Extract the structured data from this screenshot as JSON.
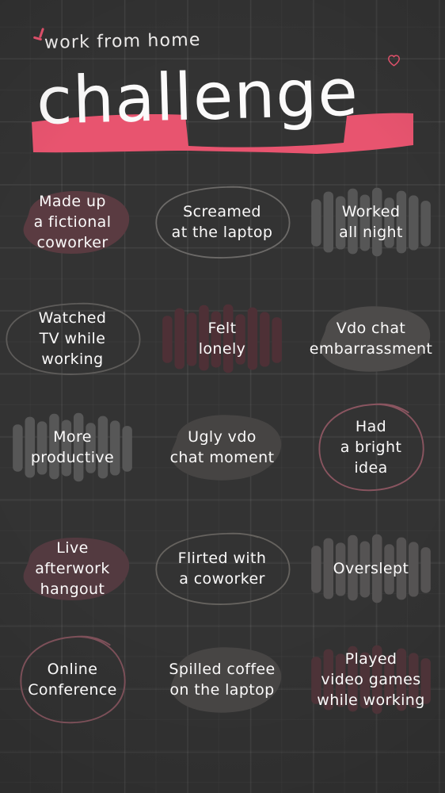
{
  "poster": {
    "background_color": "#333333",
    "accent_color": "#e8546f",
    "text_color": "#fbfafa",
    "kicker": "work from home",
    "headline": "challenge",
    "heart_icon": "heart-icon",
    "banner_color": "#e8546f"
  },
  "cells": [
    {
      "id": "made-up-a-fictional-coworker",
      "text": "Made up\na fictional\ncoworker",
      "highlight": "blob-maroon",
      "highlight_color": "#5a3b41",
      "row": 1,
      "col": 1
    },
    {
      "id": "screamed-at-the-laptop",
      "text": "Screamed\nat the laptop",
      "highlight": "outline-oval-gray",
      "highlight_color": "#6c6a68",
      "row": 1,
      "col": 2
    },
    {
      "id": "worked-all-night",
      "text": "Worked\nall night",
      "highlight": "brush-gray",
      "highlight_color": "#565656",
      "row": 1,
      "col": 3
    },
    {
      "id": "watched-tv-while-working",
      "text": "Watched\nTV while\nworking",
      "highlight": "outline-oval-gray",
      "highlight_color": "#5e5c5a",
      "row": 2,
      "col": 1
    },
    {
      "id": "felt-lonely",
      "text": "Felt\nlonely",
      "highlight": "brush-maroon",
      "highlight_color": "#4e3036",
      "row": 2,
      "col": 2
    },
    {
      "id": "vdo-chat-embarrassment",
      "text": "Vdo chat\nembarrassment",
      "highlight": "blob-gray",
      "highlight_color": "#4d4b4a",
      "row": 2,
      "col": 3
    },
    {
      "id": "more-productive",
      "text": "More\nproductive",
      "highlight": "brush-gray",
      "highlight_color": "#575757",
      "row": 3,
      "col": 1
    },
    {
      "id": "ugly-vdo-chat-moment",
      "text": "Ugly vdo\nchat moment",
      "highlight": "blob-gray",
      "highlight_color": "#464443",
      "row": 3,
      "col": 2
    },
    {
      "id": "had-a-bright-idea",
      "text": "Had\na bright\nidea",
      "highlight": "outline-circle-pink",
      "highlight_color": "#8a5560",
      "row": 3,
      "col": 3
    },
    {
      "id": "live-afterwork-hangout",
      "text": "Live\nafterwork\nhangout",
      "highlight": "blob-maroon",
      "highlight_color": "#533a40",
      "row": 4,
      "col": 1
    },
    {
      "id": "flirted-with-a-coworker",
      "text": "Flirted with\na coworker",
      "highlight": "outline-oval-gray",
      "highlight_color": "#66635f",
      "row": 4,
      "col": 2
    },
    {
      "id": "overslept",
      "text": "Overslept",
      "highlight": "brush-gray",
      "highlight_color": "#555353",
      "row": 4,
      "col": 3
    },
    {
      "id": "online-conference",
      "text": "Online\nConference",
      "highlight": "outline-circle-pink",
      "highlight_color": "#7d5059",
      "row": 5,
      "col": 1
    },
    {
      "id": "spilled-coffee-on-the-laptop",
      "text": "Spilled coffee\non the laptop",
      "highlight": "blob-gray",
      "highlight_color": "#474544",
      "row": 5,
      "col": 2
    },
    {
      "id": "played-video-games-while-working",
      "text": "Played\nvideo games\nwhile working",
      "highlight": "brush-maroon",
      "highlight_color": "#4d3338",
      "row": 5,
      "col": 3
    }
  ]
}
